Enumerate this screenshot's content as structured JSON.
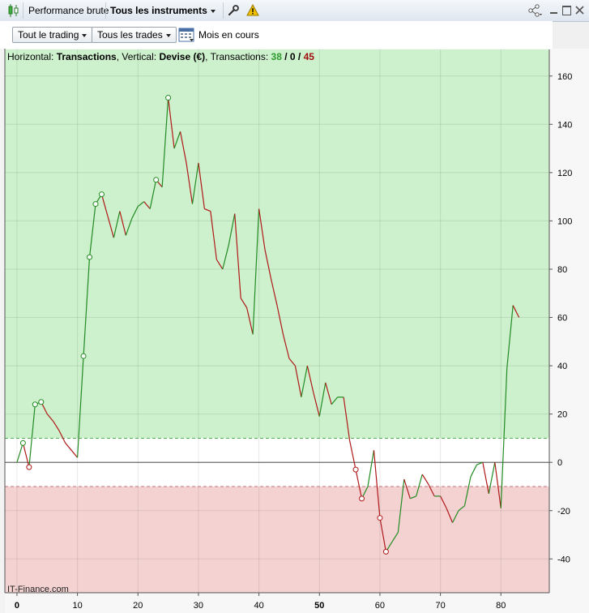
{
  "window": {
    "tab_label": "Performance brute",
    "instrument_selector": "Tous les instruments"
  },
  "toolbar": {
    "trading_filter": "Tout le trading",
    "trades_filter": "Tous les trades",
    "period_label": "Mois en cours"
  },
  "info": {
    "horizontal_label": "Horizontal:",
    "horizontal_value": "Transactions",
    "vertical_label": "Vertical:",
    "vertical_value": "Devise (€)",
    "transactions_label": "Transactions:",
    "winning": "38",
    "neutral": "0",
    "total": "45",
    "sep1": ", ",
    "sep2": ", ",
    "slash": " / "
  },
  "watermark": "IT-Finance.com",
  "colors": {
    "profit_zone": "#cdf0cd",
    "loss_zone": "#f4d2d2",
    "up_segment": "#228b22",
    "down_segment": "#b01818",
    "winning_count": "#2e9b2e",
    "total_count": "#a01010"
  },
  "chart_data": {
    "type": "line",
    "xlabel": "",
    "ylabel": "",
    "xlim": [
      -2,
      88
    ],
    "ylim": [
      -54,
      171
    ],
    "x_ticks": [
      0,
      10,
      20,
      30,
      40,
      50,
      60,
      70,
      80
    ],
    "y_ticks": [
      160,
      140,
      120,
      100,
      80,
      60,
      40,
      20,
      0,
      -20,
      -40
    ],
    "zero_line": 0,
    "profit_band": [
      10,
      171
    ],
    "loss_band": [
      -54,
      -10
    ],
    "band_lines": [
      10,
      -10
    ],
    "grid": true,
    "series": [
      {
        "x": [
          0,
          1,
          2,
          3,
          4,
          5,
          6,
          7,
          8,
          9,
          10,
          11,
          12,
          13,
          14,
          15,
          16,
          17,
          18,
          19,
          20,
          21,
          22,
          23,
          24,
          25,
          26,
          27,
          28,
          29,
          30,
          31,
          32,
          33,
          34,
          35,
          36,
          37,
          38,
          39,
          40,
          41,
          42,
          43,
          44,
          45,
          46,
          47,
          48,
          49,
          50,
          51,
          52,
          53,
          54,
          55,
          56,
          57,
          58,
          59,
          60,
          61,
          62,
          63,
          64,
          65,
          66,
          67,
          68,
          69,
          70,
          71,
          72,
          73,
          74,
          75,
          76,
          77,
          78,
          79,
          80,
          81,
          82,
          83
        ],
        "values": [
          0,
          8,
          -2,
          24,
          25,
          20,
          17,
          13,
          8,
          5,
          2,
          44,
          85,
          107,
          111,
          102,
          93,
          104,
          94,
          101,
          106,
          108,
          105,
          117,
          114,
          151,
          130,
          137,
          124,
          107,
          124,
          105,
          104,
          84,
          80,
          90,
          103,
          68,
          64,
          53,
          105,
          88,
          76,
          65,
          53,
          43,
          40,
          27,
          40,
          29,
          19,
          33,
          24,
          27,
          27,
          9,
          -3,
          -15,
          -10,
          5,
          -23,
          -37,
          -33,
          -29,
          -7,
          -15,
          -14,
          -5,
          -9,
          -14,
          -14,
          -19,
          -25,
          -20,
          -18,
          -6,
          -1,
          0,
          -13,
          0,
          -19,
          39,
          65,
          60
        ]
      }
    ],
    "markers": [
      {
        "x": 1,
        "y": 8,
        "color": "#228b22"
      },
      {
        "x": 2,
        "y": -2,
        "color": "#b01818"
      },
      {
        "x": 3,
        "y": 24,
        "color": "#228b22"
      },
      {
        "x": 4,
        "y": 25,
        "color": "#228b22"
      },
      {
        "x": 11,
        "y": 44,
        "color": "#228b22"
      },
      {
        "x": 12,
        "y": 85,
        "color": "#228b22"
      },
      {
        "x": 13,
        "y": 107,
        "color": "#228b22"
      },
      {
        "x": 14,
        "y": 111,
        "color": "#228b22"
      },
      {
        "x": 23,
        "y": 117,
        "color": "#228b22"
      },
      {
        "x": 25,
        "y": 151,
        "color": "#228b22"
      },
      {
        "x": 56,
        "y": -3,
        "color": "#b01818"
      },
      {
        "x": 57,
        "y": -15,
        "color": "#b01818"
      },
      {
        "x": 60,
        "y": -23,
        "color": "#b01818"
      },
      {
        "x": 61,
        "y": -37,
        "color": "#b01818"
      }
    ]
  }
}
